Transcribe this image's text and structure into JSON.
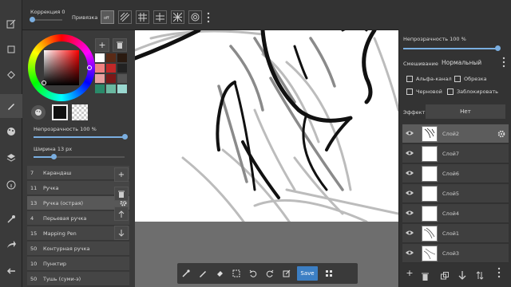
{
  "topbar": {
    "correction_label": "Коррекция",
    "correction_value": "0",
    "snap_label": "Привязка"
  },
  "brush_panel": {
    "opacity_label": "Непрозрачность 100 %",
    "width_label": "Ширина 13 px",
    "items": [
      {
        "num": "7",
        "name": "Карандаш"
      },
      {
        "num": "11",
        "name": "Ручка"
      },
      {
        "num": "13",
        "name": "Ручка (острая)"
      },
      {
        "num": "4",
        "name": "Перьевая ручка"
      },
      {
        "num": "15",
        "name": "Mapping Pen"
      },
      {
        "num": "50",
        "name": "Контурная ручка"
      },
      {
        "num": "10",
        "name": "Пунктир"
      },
      {
        "num": "50",
        "name": "Тушь (суми-э)"
      }
    ]
  },
  "layer_panel": {
    "opacity_label": "Непрозрачность 100 %",
    "blend_label": "Смешивание",
    "blend_value": "Нормальный",
    "alpha_label": "Альфа-канал",
    "clip_label": "Обрезка",
    "draft_label": "Черновой",
    "lock_label": "Заблокировать",
    "effect_label": "Эффект",
    "effect_value": "Нет",
    "layers": [
      {
        "name": "Слой2"
      },
      {
        "name": "Слой7"
      },
      {
        "name": "Слой6"
      },
      {
        "name": "Слой5"
      },
      {
        "name": "Слой4"
      },
      {
        "name": "Слой1"
      },
      {
        "name": "Слой3"
      }
    ]
  },
  "bottombar": {
    "save_label": "Save"
  },
  "colors": {
    "accent": "#3c7fc4",
    "palette": [
      "#ffffff",
      "#5a2a16",
      "#2a1a10",
      "#f08080",
      "#c02828",
      "#222222",
      "#e8a0a0",
      "#7a1818",
      "#555555",
      "#2a8a6a",
      "#6ab8a0",
      "#9ad8d0"
    ]
  }
}
